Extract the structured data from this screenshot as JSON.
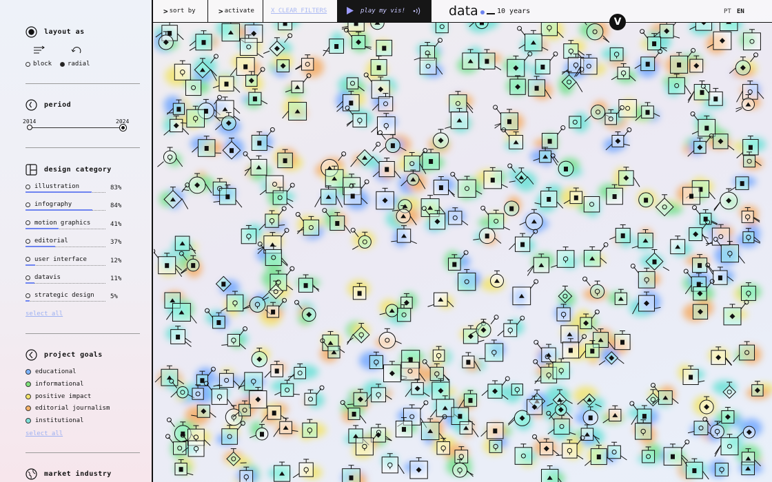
{
  "sidebar": {
    "layout": {
      "title": "layout as",
      "options": [
        {
          "label": "block",
          "selected": false
        },
        {
          "label": "radial",
          "selected": true
        }
      ]
    },
    "period": {
      "title": "period",
      "start": "2014",
      "end": "2024"
    },
    "design_category": {
      "title": "design category",
      "items": [
        {
          "label": "illustration",
          "pct": "83%",
          "value": 0.83
        },
        {
          "label": "infography",
          "pct": "84%",
          "value": 0.84
        },
        {
          "label": "motion graphics",
          "pct": "41%",
          "value": 0.41
        },
        {
          "label": "editorial",
          "pct": "37%",
          "value": 0.37
        },
        {
          "label": "user interface",
          "pct": "12%",
          "value": 0.12
        },
        {
          "label": "datavis",
          "pct": "11%",
          "value": 0.11
        },
        {
          "label": "strategic design",
          "pct": "5%",
          "value": 0.05
        }
      ],
      "select_all": "select all"
    },
    "project_goals": {
      "title": "project goals",
      "items": [
        {
          "label": "educational",
          "color": "#7db4ff"
        },
        {
          "label": "informational",
          "color": "#7fe07a"
        },
        {
          "label": "positive impact",
          "color": "#f4e46a"
        },
        {
          "label": "editorial journalism",
          "color": "#f7b268"
        },
        {
          "label": "institutional",
          "color": "#7fe0d8"
        }
      ],
      "select_all": "select all"
    },
    "market_industry": {
      "title": "market industry"
    }
  },
  "topbar": {
    "sort_by": "sort by",
    "activate": "activate",
    "clear_filters": "X CLEAR FILTERS",
    "play": "play my vis!",
    "logo": "data",
    "years": "10 years",
    "lang_pt": "PT",
    "lang_en": "EN"
  },
  "badge": "V",
  "colors": {
    "accent": "#6d83f0",
    "play_bg": "#161616",
    "play_text": "#c9c8ff",
    "blob_palette": [
      "#6fa6ff",
      "#6fe08a",
      "#f2e46a",
      "#f5ab62",
      "#67e1d6"
    ]
  }
}
